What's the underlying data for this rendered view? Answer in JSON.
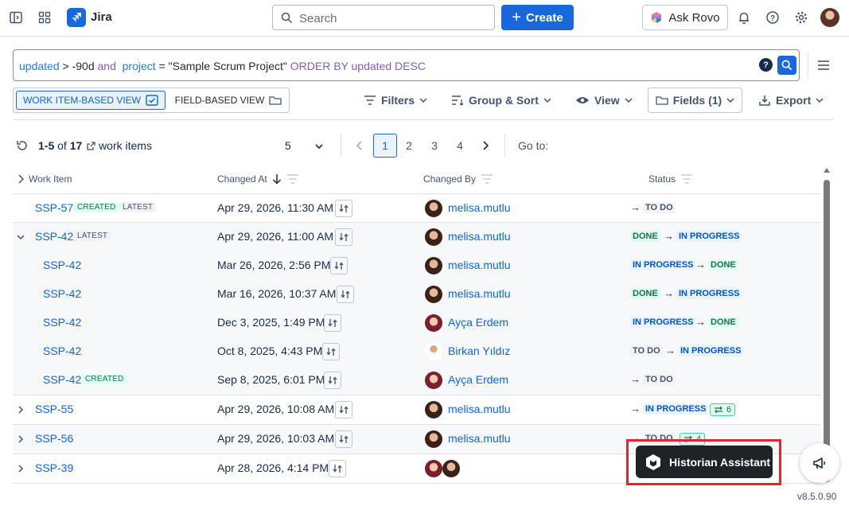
{
  "topbar": {
    "brand": "Jira",
    "search_placeholder": "Search",
    "create_label": "Create",
    "rovo_label": "Ask Rovo"
  },
  "jql": {
    "t1": "updated",
    "t2": " > ",
    "t3": "-90d",
    "t4": " and ",
    "t5": " project",
    "t6": " = ",
    "t7": "\"Sample Scrum Project\"",
    "t8": " ORDER BY ",
    "t9": "updated",
    "t10": " DESC"
  },
  "view": {
    "work_item_based": "WORK ITEM-BASED VIEW",
    "field_based": "FIELD-BASED VIEW",
    "filters": "Filters",
    "group_sort": "Group & Sort",
    "view": "View",
    "fields": "Fields (1)",
    "export": "Export"
  },
  "pagination": {
    "range": "1-5",
    "of": " of ",
    "total": "17",
    "items_label": "work items",
    "page_size": "5",
    "pages": [
      "1",
      "2",
      "3",
      "4"
    ],
    "current_page": "1",
    "goto_label": "Go to:"
  },
  "columns": {
    "work_item": "Work Item",
    "changed_at": "Changed At",
    "changed_by": "Changed By",
    "status": "Status"
  },
  "rows": [
    {
      "key": "SSP-57",
      "tags": [
        "CREATED",
        "LATEST"
      ],
      "date": "Apr 29, 2026, 11:30 AM",
      "user": "melisa.mutlu",
      "from": "",
      "to": "TO DO",
      "changes": ""
    },
    {
      "key": "SSP-42",
      "tags": [
        "LATEST"
      ],
      "date": "Apr 29, 2026, 11:00 AM",
      "user": "melisa.mutlu",
      "from": "DONE",
      "to": "IN PROGRESS",
      "changes": ""
    },
    {
      "key": "SSP-42",
      "tags": [],
      "date": "Mar 26, 2026, 2:56 PM",
      "user": "melisa.mutlu",
      "from": "IN PROGRESS",
      "to": "DONE",
      "changes": ""
    },
    {
      "key": "SSP-42",
      "tags": [],
      "date": "Mar 16, 2026, 10:37 AM",
      "user": "melisa.mutlu",
      "from": "DONE",
      "to": "IN PROGRESS",
      "changes": ""
    },
    {
      "key": "SSP-42",
      "tags": [],
      "date": "Dec 3, 2025, 1:49 PM",
      "user": "Ayça Erdem",
      "from": "IN PROGRESS",
      "to": "DONE",
      "changes": ""
    },
    {
      "key": "SSP-42",
      "tags": [],
      "date": "Oct 8, 2025, 4:43 PM",
      "user": "Birkan Yıldız",
      "from": "TO DO",
      "to": "IN PROGRESS",
      "changes": ""
    },
    {
      "key": "SSP-42",
      "tags": [
        "CREATED"
      ],
      "date": "Sep 8, 2025, 6:01 PM",
      "user": "Ayça Erdem",
      "from": "",
      "to": "TO DO",
      "changes": ""
    },
    {
      "key": "SSP-55",
      "tags": [],
      "date": "Apr 29, 2026, 10:08 AM",
      "user": "melisa.mutlu",
      "from": "",
      "to": "IN PROGRESS",
      "changes": "6"
    },
    {
      "key": "SSP-56",
      "tags": [],
      "date": "Apr 29, 2026, 10:03 AM",
      "user": "melisa.mutlu",
      "from": "",
      "to": "TO DO",
      "changes": "4"
    },
    {
      "key": "SSP-39",
      "tags": [],
      "date": "Apr 28, 2026, 4:14 PM",
      "user": "",
      "from": "",
      "to": "",
      "changes": ""
    }
  ],
  "overlay": {
    "historian_label": "Historian Assistant",
    "version": "v8.5.0.90"
  },
  "colors": {
    "brand_blue": "#1868db",
    "link_blue": "#0c66e4",
    "highlight_red": "#e0262f"
  }
}
